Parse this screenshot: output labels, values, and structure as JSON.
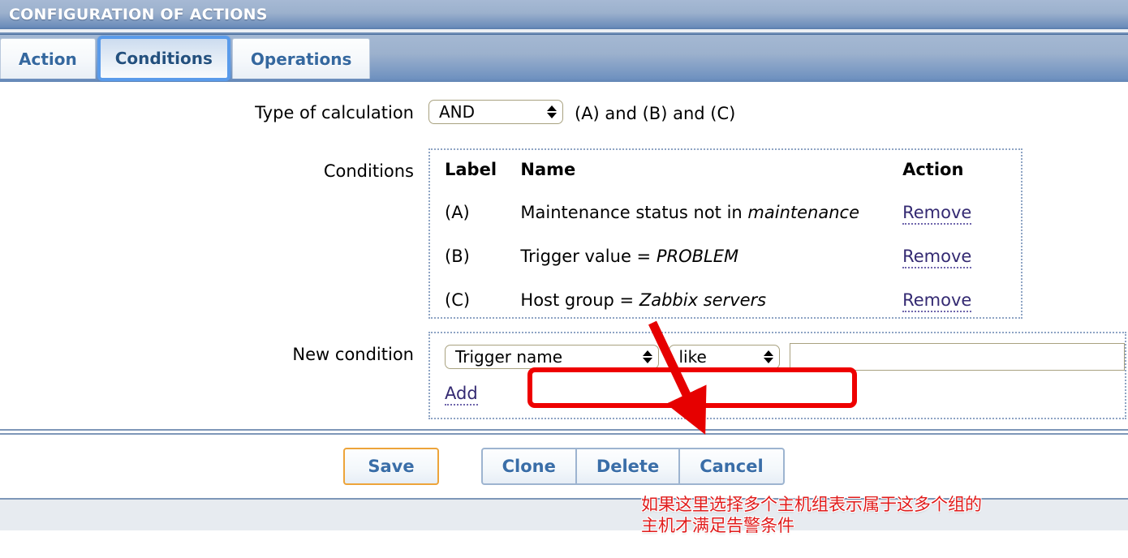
{
  "window": {
    "title": "CONFIGURATION OF ACTIONS"
  },
  "tabs": [
    {
      "label": "Action",
      "selected": false
    },
    {
      "label": "Conditions",
      "selected": true
    },
    {
      "label": "Operations",
      "selected": false
    }
  ],
  "form": {
    "calculation": {
      "label": "Type of calculation",
      "value": "AND",
      "formula": "(A) and (B) and (C)"
    },
    "conditions": {
      "label": "Conditions",
      "headers": {
        "label": "Label",
        "name": "Name",
        "action": "Action"
      },
      "rows": [
        {
          "label": "(A)",
          "name_prefix": "Maintenance status not in ",
          "name_value": "maintenance",
          "action": "Remove",
          "highlighted": false
        },
        {
          "label": "(B)",
          "name_prefix": "Trigger value = ",
          "name_value": "PROBLEM",
          "action": "Remove",
          "highlighted": false
        },
        {
          "label": "(C)",
          "name_prefix": "Host group = ",
          "name_value": "Zabbix servers",
          "action": "Remove",
          "highlighted": true
        }
      ]
    },
    "new_condition": {
      "label": "New condition",
      "condition_type": "Trigger name",
      "operator": "like",
      "value": "",
      "value_placeholder": "",
      "add_label": "Add"
    }
  },
  "annotation": {
    "line1": "如果这里选择多个主机组表示属于这多个组的",
    "line2": "主机才满足告警条件",
    "color": "#e01b1b"
  },
  "footer": {
    "save": "Save",
    "clone": "Clone",
    "delete": "Delete",
    "cancel": "Cancel"
  },
  "colors": {
    "header_gradient_top": "#a6b9d4",
    "header_gradient_bottom": "#5b80b0",
    "tab_selected_border": "#5a9bea",
    "link": "#342a72",
    "highlight_red": "#ee0000",
    "save_border": "#eda43a"
  }
}
